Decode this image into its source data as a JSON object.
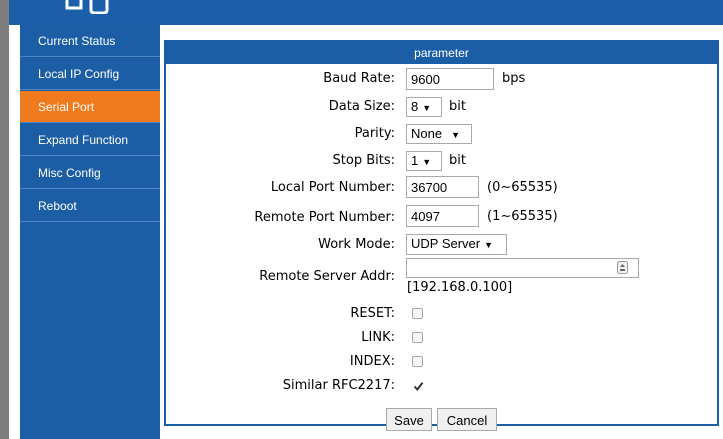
{
  "sidebar": {
    "items": [
      {
        "label": "Current Status"
      },
      {
        "label": "Local IP Config"
      },
      {
        "label": "Serial Port"
      },
      {
        "label": "Expand Function"
      },
      {
        "label": "Misc Config"
      },
      {
        "label": "Reboot"
      }
    ],
    "active_index": 2
  },
  "panel": {
    "title": "parameter",
    "baud_rate": {
      "label": "Baud Rate:",
      "value": "9600",
      "unit": "bps"
    },
    "data_size": {
      "label": "Data Size:",
      "value": "8",
      "unit": "bit"
    },
    "parity": {
      "label": "Parity:",
      "value": "None"
    },
    "stop_bits": {
      "label": "Stop Bits:",
      "value": "1",
      "unit": "bit"
    },
    "local_port": {
      "label": "Local Port Number:",
      "value": "36700",
      "range": "(0~65535)"
    },
    "remote_port": {
      "label": "Remote Port Number:",
      "value": "4097",
      "range": "(1~65535)"
    },
    "work_mode": {
      "label": "Work Mode:",
      "value": "UDP Server"
    },
    "remote_server": {
      "label": "Remote Server Addr:",
      "value": "",
      "hint": "[192.168.0.100]"
    },
    "reset": {
      "label": "RESET:",
      "checked": false
    },
    "link": {
      "label": "LINK:",
      "checked": false
    },
    "index": {
      "label": "INDEX:",
      "checked": false
    },
    "rfc2217": {
      "label": "Similar RFC2217:",
      "checked": true
    }
  },
  "actions": {
    "save": "Save",
    "cancel": "Cancel"
  },
  "colors": {
    "header_blue": "#1c5ea5",
    "active_orange": "#f07b1f",
    "left_bar_gray": "#7d7d7d"
  }
}
